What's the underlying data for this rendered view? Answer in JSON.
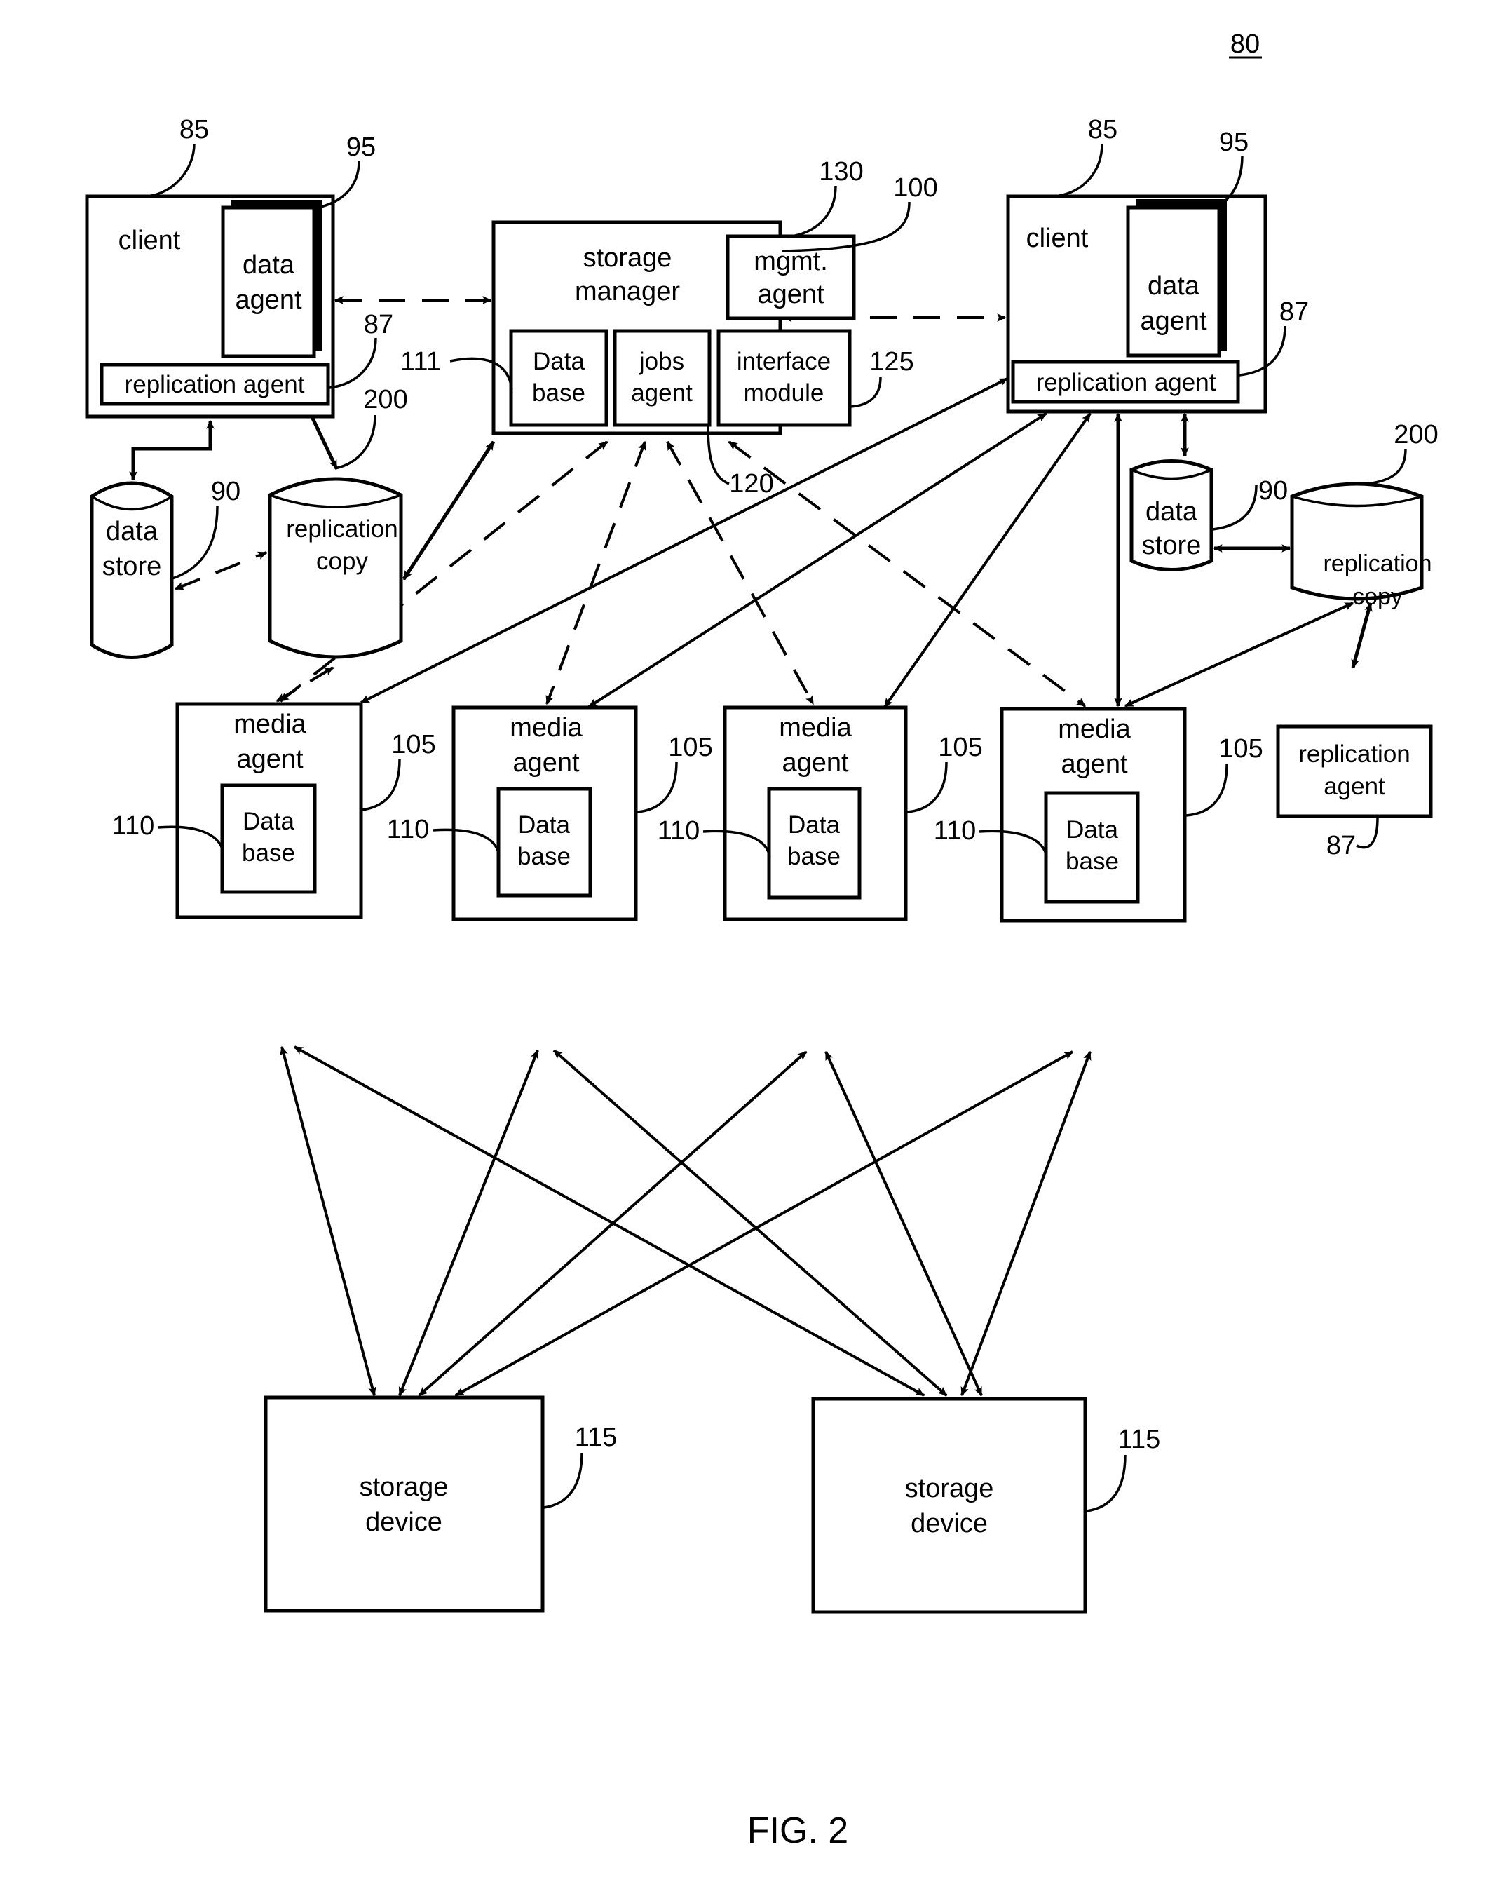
{
  "figure": {
    "number_ref": "80",
    "caption": "FIG. 2"
  },
  "clients": [
    {
      "label": "client",
      "ref": "85",
      "data_agent": {
        "line1": "data",
        "line2": "agent",
        "ref": "95"
      },
      "replication_agent": {
        "label": "replication agent",
        "ref": "87"
      }
    },
    {
      "label": "client",
      "ref": "85",
      "data_agent": {
        "line1": "data",
        "line2": "agent",
        "ref": "95"
      },
      "replication_agent": {
        "label": "replication agent",
        "ref": "87"
      }
    }
  ],
  "storage_manager": {
    "line1": "storage",
    "line2": "manager",
    "ref": "100",
    "mgmt_agent": {
      "line1": "mgmt.",
      "line2": "agent",
      "ref": "130"
    },
    "database": {
      "line1": "Data",
      "line2": "base",
      "ref": "111"
    },
    "jobs_agent": {
      "line1": "jobs",
      "line2": "agent",
      "ref": "120"
    },
    "interface_module": {
      "line1": "interface",
      "line2": "module",
      "ref": "125"
    }
  },
  "data_stores": [
    {
      "line1": "data",
      "line2": "store",
      "ref": "90"
    },
    {
      "line1": "data",
      "line2": "store",
      "ref": "90"
    }
  ],
  "replication_copies": [
    {
      "line1": "replication",
      "line2": "copy",
      "ref": "200"
    },
    {
      "line1": "replication",
      "line2": "copy",
      "ref": "200"
    }
  ],
  "standalone_replication_agent": {
    "line1": "replication",
    "line2": "agent",
    "ref": "87"
  },
  "media_agents": [
    {
      "line1": "media",
      "line2": "agent",
      "ref": "105",
      "db": {
        "line1": "Data",
        "line2": "base",
        "ref": "110"
      }
    },
    {
      "line1": "media",
      "line2": "agent",
      "ref": "105",
      "db": {
        "line1": "Data",
        "line2": "base",
        "ref": "110"
      }
    },
    {
      "line1": "media",
      "line2": "agent",
      "ref": "105",
      "db": {
        "line1": "Data",
        "line2": "base",
        "ref": "110"
      }
    },
    {
      "line1": "media",
      "line2": "agent",
      "ref": "105",
      "db": {
        "line1": "Data",
        "line2": "base",
        "ref": "110"
      }
    }
  ],
  "storage_devices": [
    {
      "line1": "storage",
      "line2": "device",
      "ref": "115"
    },
    {
      "line1": "storage",
      "line2": "device",
      "ref": "115"
    }
  ]
}
